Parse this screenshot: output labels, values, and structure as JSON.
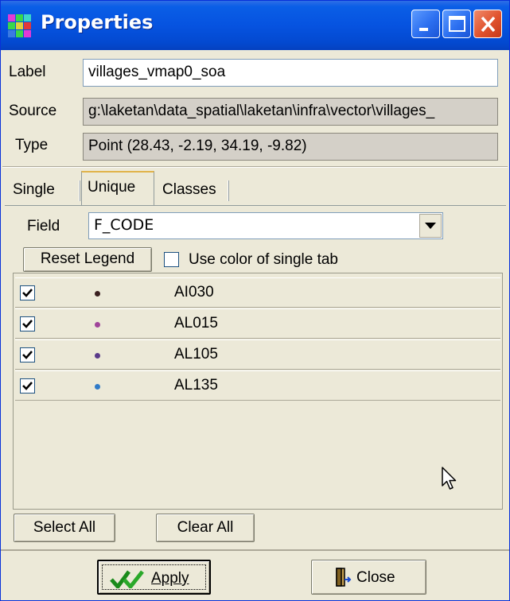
{
  "window": {
    "title": "Properties",
    "buttons": [
      "minimize",
      "maximize",
      "close"
    ]
  },
  "properties": {
    "label_caption": "Label",
    "label_value": "villages_vmap0_soa",
    "source_caption": "Source",
    "source_value": "g:\\laketan\\data_spatial\\laketan\\infra\\vector\\villages_",
    "type_caption": "Type",
    "type_value": "Point  (28.43, -2.19, 34.19, -9.82)"
  },
  "tabs": [
    {
      "label": "Single",
      "active": false
    },
    {
      "label": "Unique",
      "active": true
    },
    {
      "label": "Classes",
      "active": false
    }
  ],
  "unique": {
    "field_caption": "Field",
    "field_value": "F_CODE",
    "reset_legend_label": "Reset Legend",
    "use_color_label": "Use color of single tab",
    "use_color_checked": false,
    "items": [
      {
        "code": "AI030",
        "checked": true,
        "color": "#3a1f1f"
      },
      {
        "code": "AL015",
        "checked": true,
        "color": "#a0449a"
      },
      {
        "code": "AL105",
        "checked": true,
        "color": "#5a3a8a"
      },
      {
        "code": "AL135",
        "checked": true,
        "color": "#2f7ac8"
      }
    ],
    "select_all_label": "Select All",
    "clear_all_label": "Clear All"
  },
  "footer": {
    "apply_label": "Apply",
    "close_label": "Close"
  },
  "icons": [
    "app-grid-icon",
    "minimize-icon",
    "maximize-icon",
    "close-icon",
    "dropdown-arrow-icon",
    "checkmark-icon",
    "door-exit-icon",
    "mouse-cursor-icon"
  ]
}
